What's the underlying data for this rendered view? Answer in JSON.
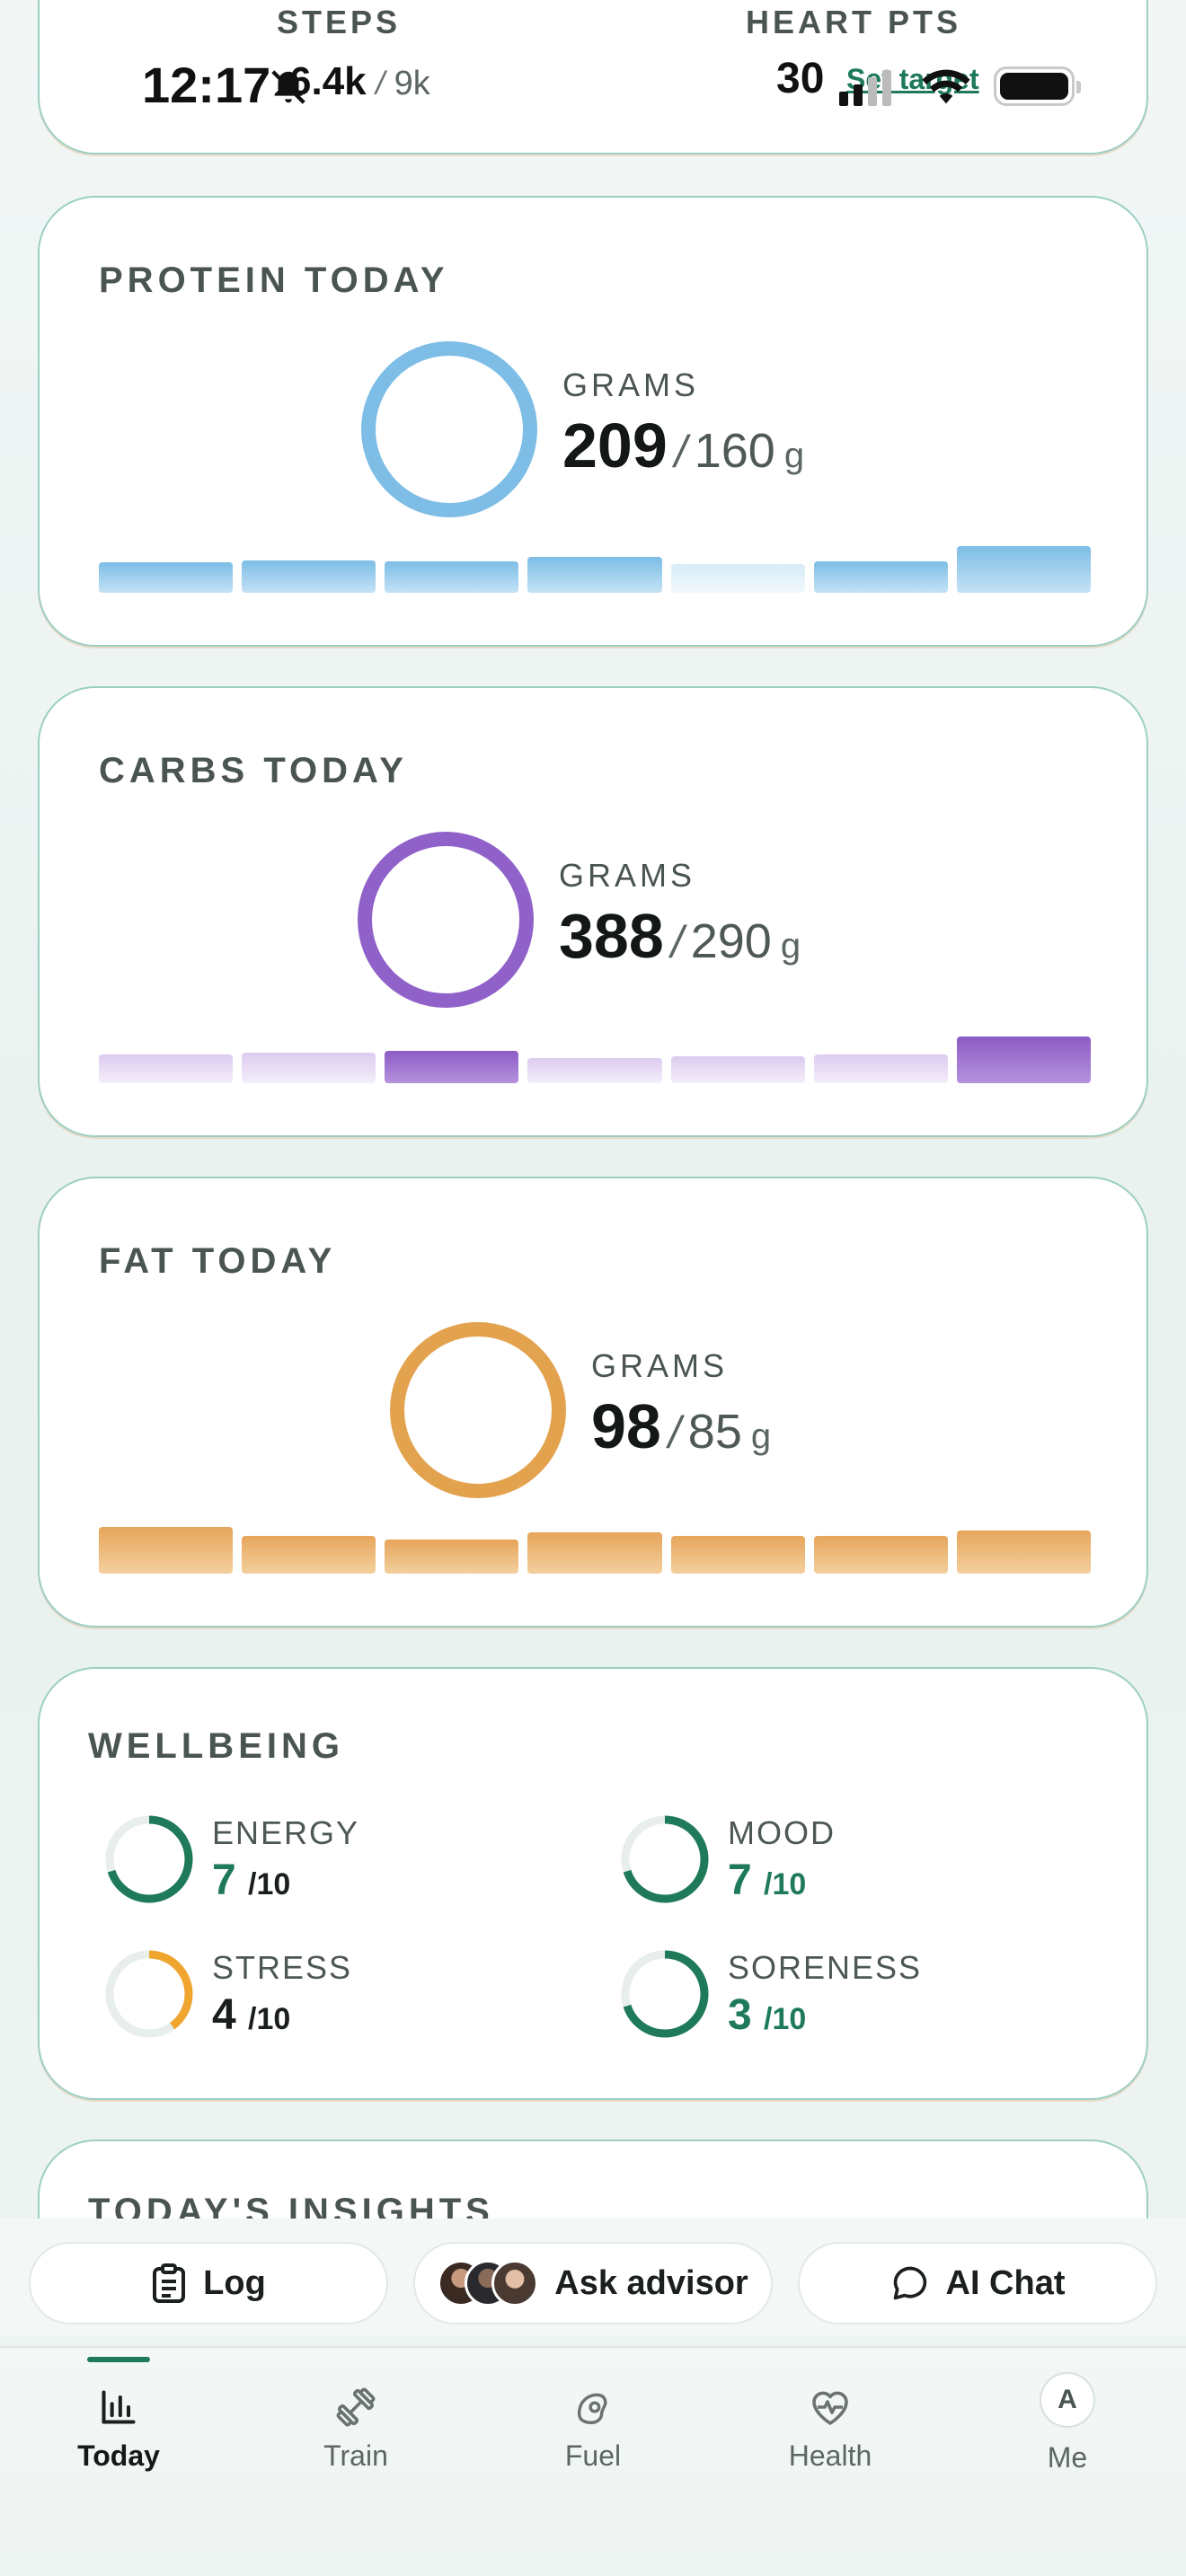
{
  "status_bar": {
    "time": "12:17"
  },
  "activity_card": {
    "steps_label": "STEPS",
    "steps_value": "6.4k",
    "steps_target": "9k",
    "heart_label": "HEART PTS",
    "heart_value": "30",
    "set_target_label": "Set target"
  },
  "protein": {
    "title": "PROTEIN TODAY",
    "unit_label": "GRAMS",
    "value": "209",
    "sep": "/",
    "target": "160",
    "unit": "g",
    "color": "#7dbde6"
  },
  "carbs": {
    "title": "CARBS TODAY",
    "unit_label": "GRAMS",
    "value": "388",
    "sep": "/",
    "target": "290",
    "unit": "g",
    "color": "#9062c9"
  },
  "fat": {
    "title": "FAT TODAY",
    "unit_label": "GRAMS",
    "value": "98",
    "sep": "/",
    "target": "85",
    "unit": "g",
    "color": "#e3a24e"
  },
  "wellbeing": {
    "title": "WELLBEING",
    "items": [
      {
        "label": "ENERGY",
        "value": "7",
        "of": "/10",
        "level": 0.7,
        "color": "#1e7a58"
      },
      {
        "label": "MOOD",
        "value": "7",
        "of": "/10",
        "level": 0.7,
        "color": "#1e7a58"
      },
      {
        "label": "STRESS",
        "value": "4",
        "of": "/10",
        "level": 0.4,
        "color": "#efa52e"
      },
      {
        "label": "SORENESS",
        "value": "3",
        "of": "/10",
        "level": 0.7,
        "color": "#1e7a58"
      }
    ]
  },
  "insights": {
    "title": "TODAY'S INSIGHTS"
  },
  "actions": {
    "log_label": "Log",
    "advisor_label": "Ask advisor",
    "chat_label": "AI Chat"
  },
  "tabs": [
    {
      "label": "Today",
      "icon": "bar-chart-icon",
      "active": true
    },
    {
      "label": "Train",
      "icon": "dumbbell-icon",
      "active": false
    },
    {
      "label": "Fuel",
      "icon": "food-icon",
      "active": false
    },
    {
      "label": "Health",
      "icon": "heart-pulse-icon",
      "active": false
    },
    {
      "label": "Me",
      "icon": "avatar-icon",
      "avatar_letter": "A",
      "active": false
    }
  ]
}
